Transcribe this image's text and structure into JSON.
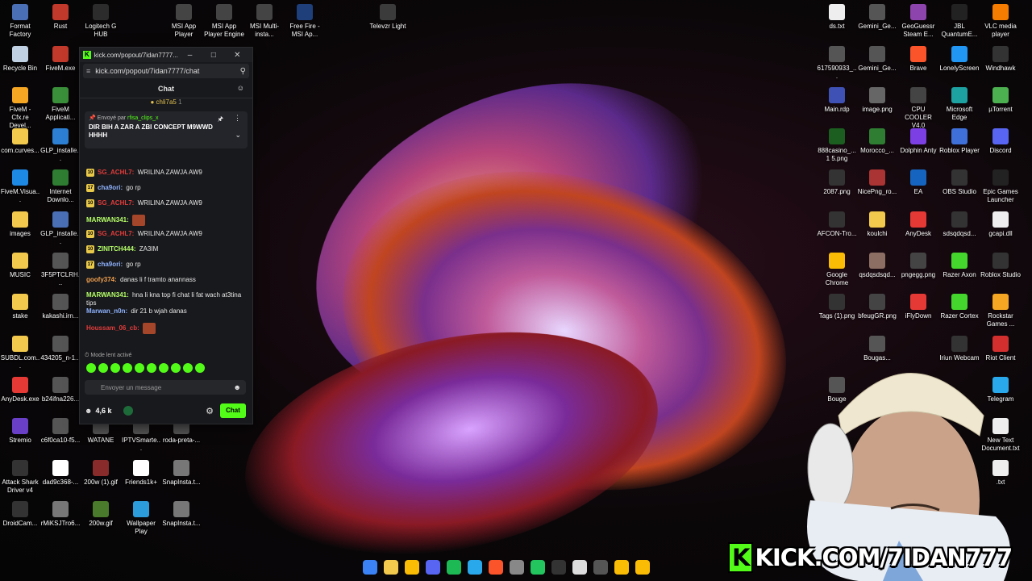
{
  "desktop_left": [
    {
      "label": "Format Factory",
      "color": "#4a6fb5",
      "icon": "format-factory-icon"
    },
    {
      "label": "Rust",
      "color": "#c0392b",
      "icon": "rust-icon"
    },
    {
      "label": "Logitech G HUB",
      "color": "#2c2c2c",
      "icon": "logitech-icon"
    },
    {
      "label": "MSI App Player",
      "color": "#444",
      "icon": "msi-icon"
    },
    {
      "label": "MSI App Player Engine",
      "color": "#444",
      "icon": "msi-icon"
    },
    {
      "label": "MSI Multi-insta...",
      "color": "#444",
      "icon": "msi-icon"
    },
    {
      "label": "Free Fire - MSI Ap...",
      "color": "#1e3f7a",
      "icon": "freefire-icon"
    },
    {
      "label": "Televzr Light",
      "color": "#3b3b3b",
      "icon": "televzr-icon"
    },
    {
      "label": "Recycle Bin",
      "color": "#bfd1e3",
      "icon": "recycle-bin-icon"
    },
    {
      "label": "FiveM.exe",
      "color": "#c0392b",
      "icon": "fivem-icon"
    },
    {
      "label": "FiveM - Cfx.re Devel...",
      "color": "#f5a623",
      "icon": "fivem-icon"
    },
    {
      "label": "FiveM Applicati...",
      "color": "#3a8f3a",
      "icon": "fivem-icon"
    },
    {
      "label": "com.curves...",
      "color": "#f2c94c",
      "icon": "folder-icon"
    },
    {
      "label": "GLP_installe...",
      "color": "#2d7fd3",
      "icon": "installer-icon"
    },
    {
      "label": "FiveM.Visua...",
      "color": "#1e88e5",
      "icon": "edge-icon"
    },
    {
      "label": "Internet Downlo...",
      "color": "#2e7d32",
      "icon": "idm-icon"
    },
    {
      "label": "images",
      "color": "#f2c94c",
      "icon": "folder-icon"
    },
    {
      "label": "GLP_installe...",
      "color": "#4a6fb5",
      "icon": "installer-icon"
    },
    {
      "label": "MUSIC",
      "color": "#f2c94c",
      "icon": "folder-icon"
    },
    {
      "label": "3F5PTCLRH...",
      "color": "#555",
      "icon": "image-icon"
    },
    {
      "label": "stake",
      "color": "#f2c94c",
      "icon": "folder-icon"
    },
    {
      "label": "kakashi.irn...",
      "color": "#555",
      "icon": "image-icon"
    },
    {
      "label": "SUBDL.com...",
      "color": "#f2c94c",
      "icon": "folder-icon"
    },
    {
      "label": "434205_n-1...",
      "color": "#555",
      "icon": "image-icon"
    },
    {
      "label": "AnyDesk.exe",
      "color": "#e53935",
      "icon": "anydesk-icon"
    },
    {
      "label": "b24ifna226...",
      "color": "#555",
      "icon": "image-icon"
    },
    {
      "label": "Stremio",
      "color": "#6a3fc8",
      "icon": "stremio-icon"
    },
    {
      "label": "c6f0ca10-f5...",
      "color": "#555",
      "icon": "image-icon"
    },
    {
      "label": "WATANE",
      "color": "#555",
      "icon": "image-icon"
    },
    {
      "label": "IPTVSmarte...",
      "color": "#555",
      "icon": "image-icon"
    },
    {
      "label": "roda-preta-...",
      "color": "#555",
      "icon": "image-icon"
    },
    {
      "label": "Attack Shark Driver v4",
      "color": "#333",
      "icon": "driver-icon"
    },
    {
      "label": "dad9c368-...",
      "color": "#fff",
      "icon": "chrome-file-icon"
    },
    {
      "label": "200w (1).gif",
      "color": "#8a2b2b",
      "icon": "gif-icon"
    },
    {
      "label": "Friends1k+",
      "color": "#fff",
      "icon": "chrome-file-icon"
    },
    {
      "label": "SnapInsta.t...",
      "color": "#777",
      "icon": "image-icon"
    },
    {
      "label": "DroidCam...",
      "color": "#333",
      "icon": "droidcam-icon"
    },
    {
      "label": "rMiKSJTro6...",
      "color": "#777",
      "icon": "image-icon"
    },
    {
      "label": "200w.gif",
      "color": "#4a7a2b",
      "icon": "gif-icon"
    },
    {
      "label": "Wallpaper Play",
      "color": "#2d9cdb",
      "icon": "wallpaper-icon"
    },
    {
      "label": "SnapInsta.t...",
      "color": "#777",
      "icon": "image-icon"
    }
  ],
  "desktop_right": [
    {
      "label": "ds.txt",
      "color": "#eee",
      "icon": "text-file-icon"
    },
    {
      "label": "Gemini_Ge...",
      "color": "#555",
      "icon": "image-icon"
    },
    {
      "label": "GeoGuessr Steam E...",
      "color": "#8e44ad",
      "icon": "geoguessr-icon"
    },
    {
      "label": "JBL QuantumE...",
      "color": "#222",
      "icon": "jbl-icon"
    },
    {
      "label": "VLC media player",
      "color": "#f57c00",
      "icon": "vlc-icon"
    },
    {
      "label": "617590933_...",
      "color": "#555",
      "icon": "image-icon"
    },
    {
      "label": "Gemini_Ge...",
      "color": "#555",
      "icon": "image-icon"
    },
    {
      "label": "Brave",
      "color": "#fb542b",
      "icon": "brave-icon"
    },
    {
      "label": "LonelyScreen",
      "color": "#2196f3",
      "icon": "lonelyscreen-icon"
    },
    {
      "label": "Windhawk",
      "color": "#333",
      "icon": "windhawk-icon"
    },
    {
      "label": "Main.rdp",
      "color": "#3f51b5",
      "icon": "rdp-icon"
    },
    {
      "label": "image.png",
      "color": "#666",
      "icon": "image-icon"
    },
    {
      "label": "CPU COOLER V4.0",
      "color": "#444",
      "icon": "cpu-icon"
    },
    {
      "label": "Microsoft Edge",
      "color": "#1ea1a1",
      "icon": "edge-icon"
    },
    {
      "label": "µTorrent",
      "color": "#4caf50",
      "icon": "utorrent-icon"
    },
    {
      "label": "888casino_... 1 5.png",
      "color": "#1b5e20",
      "icon": "image-icon"
    },
    {
      "label": "Morocco_...",
      "color": "#2e7d32",
      "icon": "image-icon"
    },
    {
      "label": "Dolphin Anty",
      "color": "#7b3fe4",
      "icon": "dolphin-icon"
    },
    {
      "label": "Roblox Player",
      "color": "#3f6fd8",
      "icon": "roblox-icon"
    },
    {
      "label": "Discord",
      "color": "#5865f2",
      "icon": "discord-icon"
    },
    {
      "label": "2087.png",
      "color": "#333",
      "icon": "image-icon"
    },
    {
      "label": "NicePng_ro...",
      "color": "#a33",
      "icon": "image-icon"
    },
    {
      "label": "EA",
      "color": "#1565c0",
      "icon": "ea-icon"
    },
    {
      "label": "OBS Studio",
      "color": "#333",
      "icon": "obs-icon"
    },
    {
      "label": "Epic Games Launcher",
      "color": "#222",
      "icon": "epic-icon"
    },
    {
      "label": "AFCON-Tro...",
      "color": "#333",
      "icon": "image-icon"
    },
    {
      "label": "koulchi",
      "color": "#f2c94c",
      "icon": "folder-icon"
    },
    {
      "label": "AnyDesk",
      "color": "#e53935",
      "icon": "anydesk-icon"
    },
    {
      "label": "sdsqdqsd...",
      "color": "#333",
      "icon": "image-icon"
    },
    {
      "label": "gcapi.dll",
      "color": "#eee",
      "icon": "dll-icon"
    },
    {
      "label": "Google Chrome",
      "color": "#fbbc05",
      "icon": "chrome-icon"
    },
    {
      "label": "qsdqsdsqd...",
      "color": "#8d6e63",
      "icon": "image-icon"
    },
    {
      "label": "pngegg.png",
      "color": "#444",
      "icon": "image-icon"
    },
    {
      "label": "Razer Axon",
      "color": "#44d62c",
      "icon": "razer-icon"
    },
    {
      "label": "Roblox Studio",
      "color": "#333",
      "icon": "roblox-studio-icon"
    },
    {
      "label": "Tags (1).png",
      "color": "#333",
      "icon": "image-icon"
    },
    {
      "label": "bfeugGR.png",
      "color": "#444",
      "icon": "image-icon"
    },
    {
      "label": "iFlyDown",
      "color": "#e53935",
      "icon": "iflydown-icon"
    },
    {
      "label": "Razer Cortex",
      "color": "#44d62c",
      "icon": "razer-icon"
    },
    {
      "label": "Rockstar Games ...",
      "color": "#f5a623",
      "icon": "rockstar-icon"
    },
    {
      "label": "Bougas...",
      "color": "#555",
      "icon": "image-icon"
    },
    {
      "label": "Iriun Webcam",
      "color": "#333",
      "icon": "iriun-icon"
    },
    {
      "label": "Riot Client",
      "color": "#d32f2f",
      "icon": "riot-icon"
    },
    {
      "label": "Bouge",
      "color": "#555",
      "icon": "image-icon"
    },
    {
      "label": "Telegram",
      "color": "#29a9eb",
      "icon": "telegram-icon"
    },
    {
      "label": "New Text Document.txt",
      "color": "#eee",
      "icon": "text-file-icon"
    },
    {
      "label": ".txt",
      "color": "#eee",
      "icon": "text-file-icon"
    }
  ],
  "chat_window": {
    "title": "kick.com/popout/7idan7777...",
    "url": "kick.com/popout/7idan7777/chat",
    "header": "Chat",
    "top_gifter": "chli7a5",
    "top_gifter_count": "1",
    "pinned": {
      "sent_by_prefix": "Envoyé par",
      "sent_by_name": "rfisa_clips_x",
      "message": "DIR BIH A ZAR A ZBI CONCEPT M9WWD HHHH"
    },
    "messages": [
      {
        "badge": "10",
        "user": "SG_ACHL7",
        "color": "#e23c3c",
        "text": "WRILINA ZAWJA AW9"
      },
      {
        "badge": "17",
        "user": "cha9ori",
        "color": "#8fb3ff",
        "text": "go rp"
      },
      {
        "badge": "10",
        "user": "SG_ACHL7",
        "color": "#e23c3c",
        "text": "WRILINA ZAWJA AW9"
      },
      {
        "badge": "",
        "user": "MARWAN341",
        "color": "#b6ff6a",
        "text": ""
      },
      {
        "badge": "10",
        "user": "SG_ACHL7",
        "color": "#e23c3c",
        "text": "WRILINA ZAWJA AW9"
      },
      {
        "badge": "10",
        "user": "ZINITCH444",
        "color": "#b6ff6a",
        "text": "ZA3IM"
      },
      {
        "badge": "17",
        "user": "cha9ori",
        "color": "#8fb3ff",
        "text": "go rp"
      },
      {
        "badge": "",
        "user": "goofy374",
        "color": "#f0a050",
        "text": "danas li f tramto anannass"
      },
      {
        "badge": "",
        "user": "MARWAN341",
        "color": "#b6ff6a",
        "text": "hna li kna top fi chat li fat wach at3tina tips"
      },
      {
        "badge": "",
        "user": "Marwan_n0n",
        "color": "#8fb3ff",
        "text": "dir 21 b wjah danas"
      },
      {
        "badge": "",
        "user": "Houssam_06_cb",
        "color": "#e23c3c",
        "text": ""
      }
    ],
    "slow_mode": "Mode lent activé",
    "input_placeholder": "Envoyer un message",
    "viewers": "4,6 k",
    "chat_button": "Chat"
  },
  "overlay": {
    "channel": "KICK.COM/7IDAN777",
    "k": "K",
    "accent": "#53fc18"
  },
  "taskbar": [
    "windows-start-icon",
    "file-explorer-icon",
    "chrome-icon",
    "discord-icon",
    "spotify-icon",
    "app-icon",
    "brave-icon",
    "settings-icon",
    "app-icon",
    "terminal-icon",
    "notepad-icon",
    "app-icon",
    "chrome-icon",
    "chrome-icon"
  ]
}
